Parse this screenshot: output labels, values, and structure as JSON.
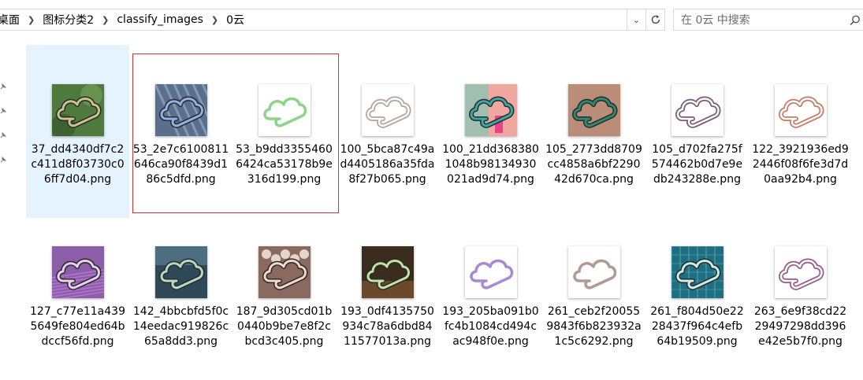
{
  "breadcrumb": [
    "桌面",
    "图标分类2",
    "classify_images",
    "0云"
  ],
  "search": {
    "placeholder": "在 0云 中搜索"
  },
  "files": [
    {
      "name": "37_dd4340df7c2c411d8f03730c06ff7d04.png",
      "bg": "#4f7a3e",
      "stroke": "#c9c38d",
      "fill": "none",
      "style": "photo-green"
    },
    {
      "name": "53_2e7c6100811646ca90f8439d186c5dfd.png",
      "bg": "#5a6f8c",
      "stroke": "#8fb1e8",
      "fill": "none",
      "style": "photo-city"
    },
    {
      "name": "53_b9dd33554606424ca53178b9e316d199.png",
      "bg": "#ffffff",
      "stroke": "#8fd38a",
      "fill": "none",
      "style": "plain"
    },
    {
      "name": "100_5bca87c49ad4405186a35fda8f27b065.png",
      "bg": "#ffffff",
      "stroke": "#b4a39b",
      "fill": "none",
      "style": "plain-outline"
    },
    {
      "name": "100_21dd3683801048b98134930021ad9d74.png",
      "bg": "#f0a7a0",
      "stroke": "#3aa9a4",
      "fill": "none",
      "style": "photo-pink"
    },
    {
      "name": "105_2773dd8709cc4858a6bf229042d670ca.png",
      "bg": "#b98d78",
      "stroke": "#2d8a70",
      "fill": "none",
      "style": "photo-skin"
    },
    {
      "name": "105_d702fa275f574462b0d7e9edb243288e.png",
      "bg": "#ffffff",
      "stroke": "#7a5a78",
      "fill": "none",
      "style": "plain-outline"
    },
    {
      "name": "122_3921936ed92446f08f6fe3d7d0aa92b4.png",
      "bg": "#ffffff",
      "stroke": "#c47b63",
      "fill": "none",
      "style": "plain-outline"
    },
    {
      "name": "127_c77e11a4395649fe804ed64bdccf56fd.png",
      "bg": "#8c5ea9",
      "stroke": "#e8d0f0",
      "fill": "none",
      "style": "photo-purple"
    },
    {
      "name": "142_4bbcbfd5f0c14eedac919826c65a8dd3.png",
      "bg": "#2e4a5a",
      "stroke": "#b8d8c6",
      "fill": "none",
      "style": "photo-dark"
    },
    {
      "name": "187_9d305cd01b0440b9be7e8f2cbcd3c405.png",
      "bg": "#8a6a5e",
      "stroke": "#f2d8cc",
      "fill": "none",
      "style": "photo-pearl"
    },
    {
      "name": "193_0df4135750934c78a6dbd8411577013a.png",
      "bg": "#3a2c1e",
      "stroke": "#c4e29e",
      "fill": "none",
      "style": "photo-brown"
    },
    {
      "name": "193_205ba091b0fc4b1084cd494cac948f0e.png",
      "bg": "#ffffff",
      "stroke": "#a88ad2",
      "fill": "none",
      "style": "plain"
    },
    {
      "name": "261_ceb2f200559843f6b823932a1c5c6292.png",
      "bg": "#ffffff",
      "stroke": "#b09a94",
      "fill": "none",
      "style": "plain"
    },
    {
      "name": "261_f804d50e2228437f964c4efb64b19509.png",
      "bg": "#1f6f80",
      "stroke": "#c8ece8",
      "fill": "none",
      "style": "photo-circuit"
    },
    {
      "name": "263_6e9f38cd2229497298dd396e42e5b7f0.png",
      "bg": "#ffffff",
      "stroke": "#9a5a88",
      "fill": "none",
      "style": "plain-outline"
    }
  ],
  "colors": {
    "selected": "#e5f3ff",
    "highlight_border": "#d0333a"
  }
}
